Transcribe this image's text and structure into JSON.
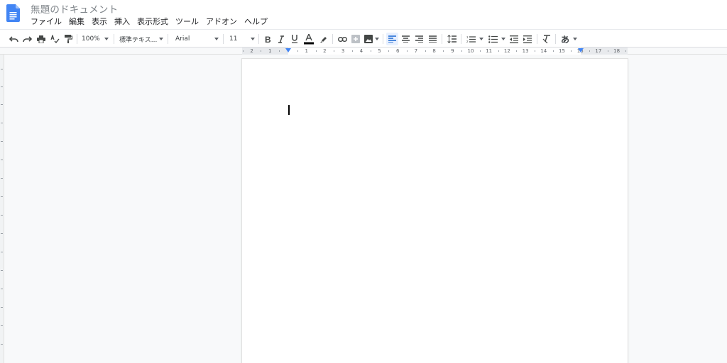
{
  "document": {
    "title": "無題のドキュメント",
    "app_icon": "google-docs-icon",
    "brand_color": "#4285f4"
  },
  "menu": {
    "items": [
      "ファイル",
      "編集",
      "表示",
      "挿入",
      "表示形式",
      "ツール",
      "アドオン",
      "ヘルプ"
    ]
  },
  "toolbar": {
    "zoom": "100%",
    "style": "標準テキス...",
    "font": "Arial",
    "font_size": "11",
    "input_tool": "あ",
    "buttons": [
      "undo-icon",
      "redo-icon",
      "print-icon",
      "spellcheck-icon",
      "paint-format-icon",
      "bold-icon",
      "italic-icon",
      "underline-icon",
      "text-color-icon",
      "highlight-icon",
      "link-icon",
      "comment-icon",
      "image-icon",
      "align-left-icon",
      "align-center-icon",
      "align-right-icon",
      "align-justify-icon",
      "line-spacing-icon",
      "numbered-list-icon",
      "bulleted-list-icon",
      "decrease-indent-icon",
      "increase-indent-icon",
      "clear-formatting-icon"
    ],
    "text_color": "#000000",
    "active_alignment": "left"
  },
  "ruler": {
    "labels": [
      "2",
      "1",
      "1",
      "2",
      "3",
      "4",
      "5",
      "6",
      "7",
      "8",
      "9",
      "10",
      "11",
      "12",
      "13",
      "14",
      "15",
      "16",
      "17",
      "18"
    ]
  }
}
